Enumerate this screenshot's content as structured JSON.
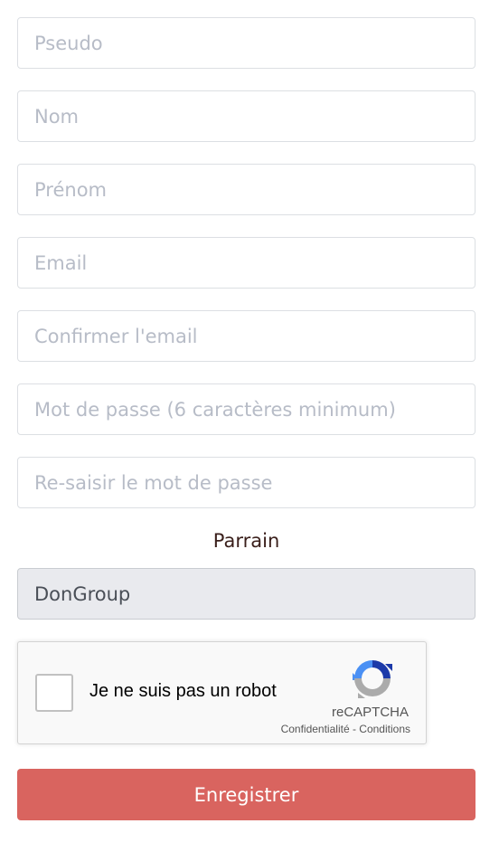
{
  "form": {
    "fields": [
      {
        "placeholder": "Pseudo",
        "value": ""
      },
      {
        "placeholder": "Nom",
        "value": ""
      },
      {
        "placeholder": "Prénom",
        "value": ""
      },
      {
        "placeholder": "Email",
        "value": ""
      },
      {
        "placeholder": "Confirmer l'email",
        "value": ""
      },
      {
        "placeholder": "Mot de passe (6 caractères minimum)",
        "value": ""
      },
      {
        "placeholder": "Re-saisir le mot de passe",
        "value": ""
      }
    ],
    "parrain_label": "Parrain",
    "parrain_value": "DonGroup",
    "submit_label": "Enregistrer",
    "submit_color": "#d9645f"
  },
  "recaptcha": {
    "checkbox_label": "Je ne suis pas un robot",
    "brand": "reCAPTCHA",
    "privacy_link": "Confidentialité",
    "separator": " - ",
    "terms_link": "Conditions",
    "logo_icon": "recaptcha-logo-icon",
    "checked": false
  }
}
